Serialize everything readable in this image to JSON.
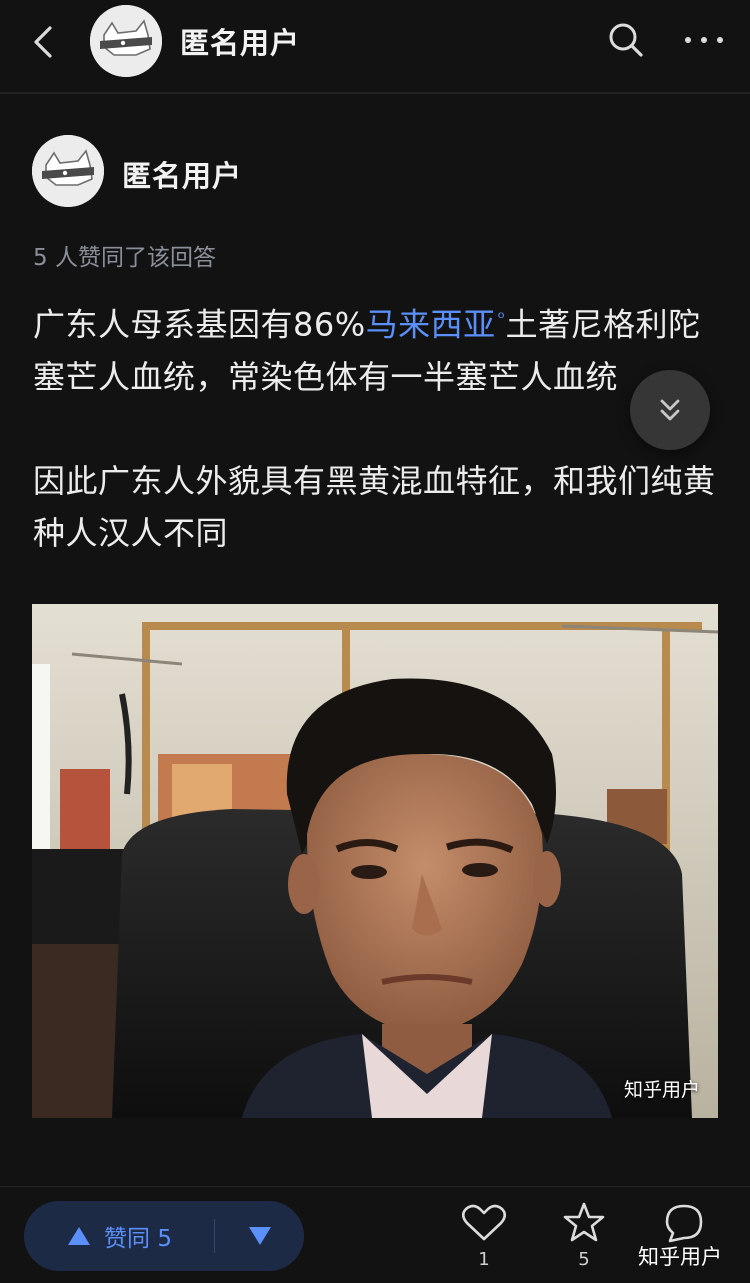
{
  "header": {
    "name": "匿名用户"
  },
  "author": {
    "name": "匿名用户",
    "votes_line": "5 人赞同了该回答"
  },
  "answer": {
    "line1_before": "广东人母系基因有86%",
    "link_text": "马来西亚",
    "line1_after": "土著尼格利陀塞芒人血统，常染色体有一半塞芒人血统",
    "para2": "因此广东人外貌具有黑黄混血特征，和我们纯黄种人汉人不同"
  },
  "photo": {
    "watermark": "知乎用户"
  },
  "bottom": {
    "upvote_label": "赞同 5",
    "like_count": "1",
    "favorite_count": "5",
    "comment_watermark": "知乎用户"
  },
  "colors": {
    "accent": "#5b8ff9",
    "background": "#121212",
    "pill": "#1c2a45"
  }
}
